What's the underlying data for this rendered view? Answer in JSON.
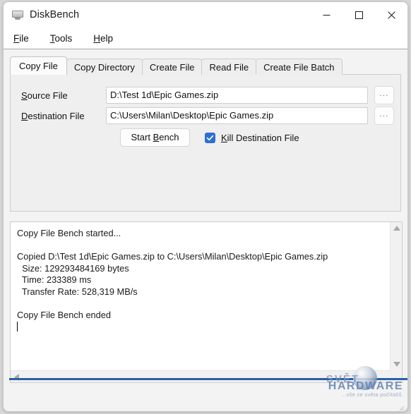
{
  "window": {
    "title": "DiskBench",
    "icon": "disk-bench-app-icon",
    "controls": {
      "minimize": "minimize-icon",
      "maximize": "maximize-icon",
      "close": "close-icon"
    }
  },
  "menubar": {
    "items": [
      {
        "label": "File",
        "mnemonic": "F"
      },
      {
        "label": "Tools",
        "mnemonic": "T"
      },
      {
        "label": "Help",
        "mnemonic": "H"
      }
    ]
  },
  "tabs": {
    "active_index": 0,
    "items": [
      {
        "label": "Copy File"
      },
      {
        "label": "Copy Directory"
      },
      {
        "label": "Create File"
      },
      {
        "label": "Read File"
      },
      {
        "label": "Create File Batch"
      }
    ]
  },
  "form": {
    "source": {
      "label_pre": "",
      "label_mnemonic": "S",
      "label_post": "ource File",
      "value": "D:\\Test 1d\\Epic Games.zip",
      "placeholder": "",
      "browse_label": "..."
    },
    "destination": {
      "label_mnemonic": "D",
      "label_post": "estination File",
      "value": "C:\\Users\\Milan\\Desktop\\Epic Games.zip",
      "placeholder": "",
      "browse_label": "..."
    },
    "start_button": {
      "pre": "Start ",
      "mnemonic": "B",
      "post": "ench"
    },
    "kill_destination": {
      "checked": true,
      "check_glyph": "✓",
      "mnemonic": "K",
      "label_post": "ill Destination File",
      "accent_color": "#2f6fd0"
    }
  },
  "log": {
    "text": "Copy File Bench started...\n\nCopied D:\\Test 1d\\Epic Games.zip to C:\\Users\\Milan\\Desktop\\Epic Games.zip\n  Size: 129293484169 bytes\n  Time: 233389 ms\n  Transfer Rate: 528,319 MB/s\n\nCopy File Bench ended\n",
    "lines": [
      "Copy File Bench started...",
      "",
      "Copied D:\\Test 1d\\Epic Games.zip to C:\\Users\\Milan\\Desktop\\Epic Games.zip",
      "  Size: 129293484169 bytes",
      "  Time: 233389 ms",
      "  Transfer Rate: 528,319 MB/s",
      "",
      "Copy File Bench ended"
    ],
    "results": {
      "source_path": "D:\\Test 1d\\Epic Games.zip",
      "destination_path": "C:\\Users\\Milan\\Desktop\\Epic Games.zip",
      "size_bytes": "129293484169",
      "size_unit": "bytes",
      "time_ms": "233389",
      "time_unit": "ms",
      "transfer_rate": "528,319",
      "transfer_rate_unit": "MB/s"
    },
    "scrollbars": {
      "vertical_up": "scroll-up-arrow-icon",
      "vertical_down": "scroll-down-arrow-icon",
      "horizontal_left": "scroll-left-arrow-icon"
    }
  },
  "watermark": {
    "word_top": "SVĚT",
    "word_bottom": "HARDWARE",
    "tagline": "...vše ze světa počítačů",
    "line_color": "#2c5fa8"
  }
}
